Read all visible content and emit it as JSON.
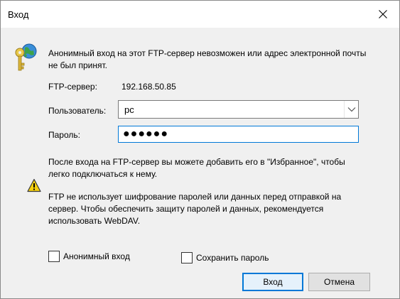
{
  "window": {
    "title": "Вход",
    "close_icon": "close-icon"
  },
  "info": {
    "icon": "keys-globe-icon",
    "text_line1": "Анонимный вход на этот FTP-сервер невозможен или адрес электронной почты",
    "text_line2": "не был принят."
  },
  "server": {
    "label": "FTP-сервер:",
    "value": "192.168.50.85"
  },
  "user": {
    "label": "Пользователь:",
    "value": "pc"
  },
  "password": {
    "label": "Пароль:",
    "masked_value": "●●●●●●"
  },
  "after_login": {
    "line1": "После входа на FTP-сервер вы можете добавить его в \"Избранное\", чтобы",
    "line2": "легко подключаться к нему."
  },
  "warning": {
    "icon": "warning-icon",
    "line1": "FTP не использует шифрование паролей или данных перед отправкой на",
    "line2": "сервер. Чтобы обеспечить защиту паролей и данных, рекомендуется",
    "line3": "использовать WebDAV."
  },
  "options": {
    "anonymous_label": "Анонимный вход",
    "anonymous_checked": false,
    "save_password_label": "Сохранить пароль",
    "save_password_checked": false
  },
  "buttons": {
    "login": "Вход",
    "cancel": "Отмена"
  },
  "colors": {
    "accent": "#0078d7",
    "dialog_bg": "#f0f0f0"
  }
}
